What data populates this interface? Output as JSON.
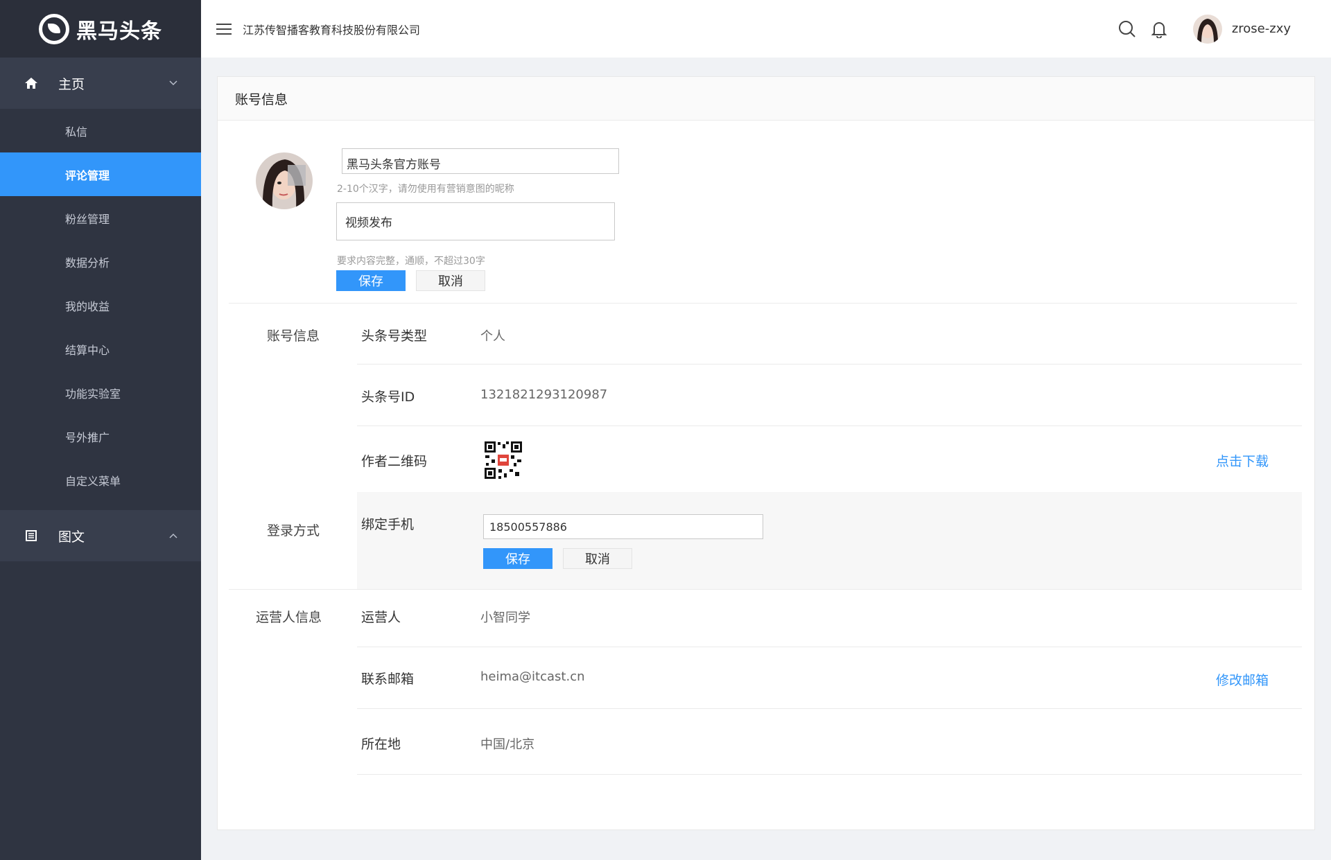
{
  "brand": {
    "name": "黑马头条"
  },
  "sidebar": {
    "groups": [
      {
        "label": "主页",
        "icon": "home-icon",
        "items": [
          {
            "label": "私信",
            "active": false
          },
          {
            "label": "评论管理",
            "active": true
          },
          {
            "label": "粉丝管理",
            "active": false
          },
          {
            "label": "数据分析",
            "active": false
          },
          {
            "label": "我的收益",
            "active": false
          },
          {
            "label": "结算中心",
            "active": false
          },
          {
            "label": "功能实验室",
            "active": false
          },
          {
            "label": "号外推广",
            "active": false
          },
          {
            "label": "自定义菜单",
            "active": false
          }
        ]
      },
      {
        "label": "图文",
        "icon": "document-icon",
        "items": []
      }
    ]
  },
  "header": {
    "company": "江苏传智播客教育科技股份有限公司",
    "username": "zrose-zxy"
  },
  "card": {
    "title": "账号信息",
    "profile": {
      "nickname_value": "黑马头条官方账号",
      "nickname_hint": "2-10个汉字，请勿使用有营销意图的昵称",
      "description_value": "视频发布",
      "description_hint": "要求内容完整，通顺，不超过30字",
      "save_label": "保存",
      "cancel_label": "取消"
    },
    "account_section": {
      "label": "账号信息",
      "rows": [
        {
          "label": "头条号类型",
          "value": "个人"
        },
        {
          "label": "头条号ID",
          "value": "1321821293120987"
        },
        {
          "label": "作者二维码",
          "link": "点击下载"
        }
      ]
    },
    "login_section": {
      "label": "登录方式",
      "row_label": "绑定手机",
      "phone_value": "18500557886",
      "save_label": "保存",
      "cancel_label": "取消"
    },
    "operator_section": {
      "label": "运营人信息",
      "rows": [
        {
          "label": "运营人",
          "value": "小智同学"
        },
        {
          "label": "联系邮箱",
          "value": "heima@itcast.cn",
          "link": "修改邮箱"
        },
        {
          "label": "所在地",
          "value": "中国/北京"
        }
      ]
    }
  },
  "colors": {
    "primary": "#3296fa",
    "sidebar": "#2f3441",
    "sidebar_group": "#383e4d"
  }
}
